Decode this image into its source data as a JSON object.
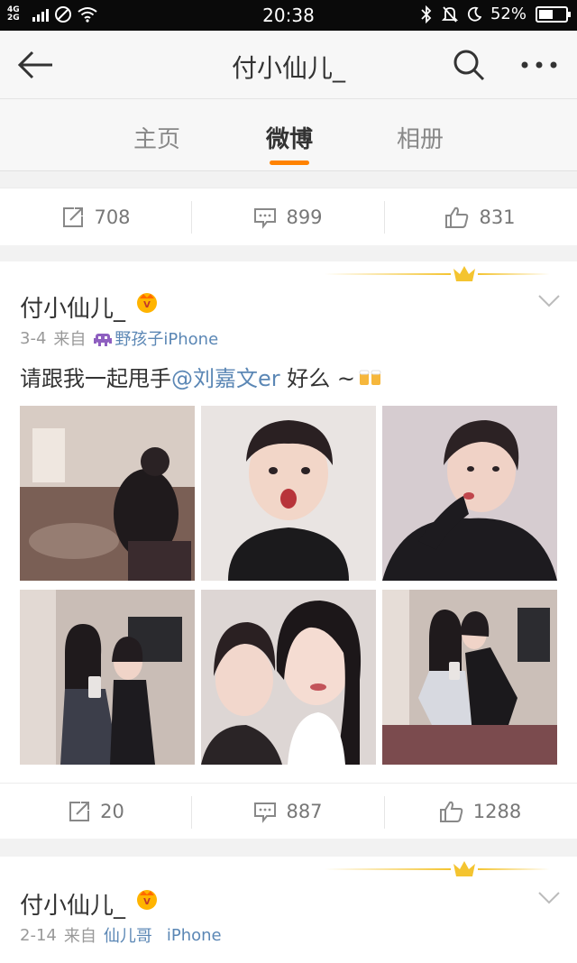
{
  "status_bar": {
    "network": "4G 2G",
    "time": "20:38",
    "battery": "52%",
    "battery_level": 0.52
  },
  "header": {
    "title": "付小仙儿_",
    "back_icon": "arrow-left-icon",
    "search_icon": "search-icon",
    "more_icon": "more-dots-icon"
  },
  "tabs": [
    {
      "label": "主页",
      "active": false
    },
    {
      "label": "微博",
      "active": true
    },
    {
      "label": "相册",
      "active": false
    }
  ],
  "accent_color": "#ff8200",
  "link_color": "#5b87b5",
  "top_actions": {
    "repost": "708",
    "comment": "899",
    "like": "831"
  },
  "post1": {
    "author": "付小仙儿_",
    "date": "3-4",
    "from_label": "来自",
    "source": "野孩子iPhone",
    "text_before": "请跟我一起甩手",
    "mention": "@刘嘉文er",
    "text_after": " 好么 ~",
    "photos": [
      {
        "icon": "photo-room-selfie"
      },
      {
        "icon": "photo-portrait-surprised"
      },
      {
        "icon": "photo-portrait-pout"
      },
      {
        "icon": "photo-mirror-duo"
      },
      {
        "icon": "photo-duo-closeup"
      },
      {
        "icon": "photo-mirror-sitting"
      }
    ],
    "actions": {
      "repost": "20",
      "comment": "887",
      "like": "1288"
    }
  },
  "post2": {
    "author": "付小仙儿_",
    "date": "2-14",
    "from_label": "来自",
    "source_part1": "仙儿哥",
    "source_part2": "iPhone"
  }
}
